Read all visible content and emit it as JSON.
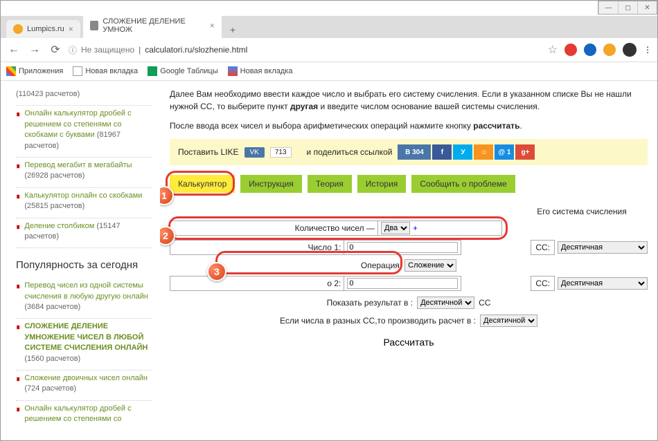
{
  "window": {
    "min": "—",
    "max": "◻",
    "close": "✕"
  },
  "browserTabs": {
    "tab1": "Lumpics.ru",
    "tab2": "СЛОЖЕНИЕ ДЕЛЕНИЕ УМНОЖ"
  },
  "nav": {
    "back": "←",
    "forward": "→",
    "reload": "⟳"
  },
  "address": {
    "info": "ⓘ",
    "warn": "Не защищено",
    "sep": "|",
    "url": "calculatori.ru/slozhenie.html"
  },
  "bookmarks": {
    "apps": "Приложения",
    "newTab1": "Новая вкладка",
    "sheets": "Google Таблицы",
    "newTab2": "Новая вкладка"
  },
  "sidebar": {
    "items": [
      {
        "text": "(110423 расчетов)"
      },
      {
        "link": "Онлайн калькулятор дробей с решением со степенями со скобками с буквами",
        "count": "(81967 расчетов)"
      },
      {
        "link": "Перевод мегабит в мегабайты",
        "count": "(26928 расчетов)"
      },
      {
        "link": "Калькулятор онлайн со скобками",
        "count": "(25815 расчетов)"
      },
      {
        "link": "Деление столбиком",
        "count": "(15147 расчетов)"
      }
    ],
    "heading": "Популярность за сегодня",
    "popular": [
      {
        "link": "Перевод чисел из одной системы счисления в любую другую онлайн",
        "count": "(3684 расчетов)"
      },
      {
        "link": "СЛОЖЕНИЕ ДЕЛЕНИЕ УМНОЖЕНИЕ ЧИСЕЛ В ЛЮБОЙ СИСТЕМЕ СЧИСЛЕНИЯ ОНЛАЙН",
        "count": "(1560 расчетов)",
        "current": true
      },
      {
        "link": "Сложение двоичных чисел онлайн",
        "count": "(724 расчетов)"
      },
      {
        "link": "Онлайн калькулятор дробей с решением со степенями со"
      }
    ]
  },
  "main": {
    "p1a": "Далее Вам необходимо ввести каждое число и выбрать его систему счисления. Если в указанном списке Вы не нашли нужной СС, то выберите пункт ",
    "p1b": "другая",
    "p1c": " и введите числом основание вашей системы счисления.",
    "p2a": "После ввода всех чисел и выбора арифметических операций нажмите кнопку ",
    "p2b": "рассчитать",
    "p2c": "."
  },
  "share": {
    "like": "Поставить LIKE",
    "vk": "VK",
    "count": "713",
    "share": "и поделиться ссылкой",
    "vkCount": "В 304",
    "fb": "f",
    "tw": "У",
    "ok": "☺",
    "mail": "@ 1",
    "gp": "g+"
  },
  "tabs": {
    "t1": "Калькулятор",
    "t2": "Инструкция",
    "t3": "Теория",
    "t4": "История",
    "t5": "Сообщить о проблеме"
  },
  "calc": {
    "countLabel": "Количество чисел —",
    "countVal": "Два",
    "plus": "+",
    "ssHeading": "Его система счисления",
    "num1": "Число 1:",
    "num1val": "0",
    "ss": "СС:",
    "ssVal": "Десятичная",
    "opLabel": "Операция:",
    "opVal": "Сложение",
    "num2": "о 2:",
    "num2val": "0",
    "showResult": "Показать результат в :",
    "resultSS": "Десятичной",
    "ssSuffix": "СС",
    "diffSS": "Если числа в разных СС,то производить расчет в :",
    "diffSSVal": "Десятичной",
    "calcBtn": "Рассчитать"
  },
  "badges": {
    "b1": "1",
    "b2": "2",
    "b3": "3"
  }
}
